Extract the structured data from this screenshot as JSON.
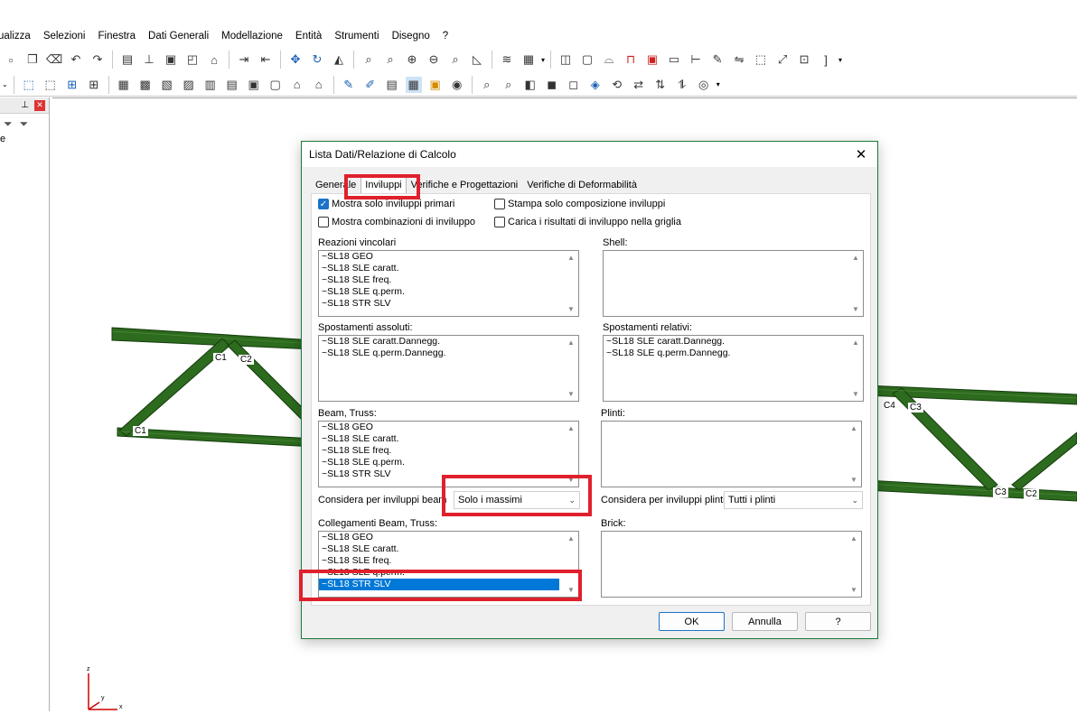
{
  "menu": [
    "ualizza",
    "Selezioni",
    "Finestra",
    "Dati Generali",
    "Modellazione",
    "Entità",
    "Strumenti",
    "Disegno",
    "?"
  ],
  "left_panel": {
    "text": "e"
  },
  "model_labels": [
    "C1",
    "C2",
    "C1",
    "C4",
    "C3",
    "C3",
    "C2"
  ],
  "dialog": {
    "title": "Lista Dati/Relazione di Calcolo",
    "tabs": [
      "Generale",
      "Inviluppi",
      "Verifiche e Progettazioni",
      "Verifiche di Deformabilità"
    ],
    "active_tab": "Inviluppi",
    "checkboxes": [
      {
        "label": "Mostra solo inviluppi primari",
        "checked": true
      },
      {
        "label": "Stampa solo composizione inviluppi",
        "checked": false
      },
      {
        "label": "Mostra combinazioni di inviluppo",
        "checked": false
      },
      {
        "label": "Carica i risultati di inviluppo nella griglia",
        "checked": false
      }
    ],
    "groups": {
      "reazioni": {
        "label": "Reazioni vincolari",
        "items": [
          "~SL18 GEO",
          "~SL18 SLE caratt.",
          "~SL18 SLE freq.",
          "~SL18 SLE q.perm.",
          "~SL18 STR SLV"
        ]
      },
      "shell": {
        "label": "Shell:",
        "items": []
      },
      "spost_ass": {
        "label": "Spostamenti assoluti:",
        "items": [
          "~SL18 SLE caratt.Dannegg.",
          "~SL18 SLE q.perm.Dannegg."
        ]
      },
      "spost_rel": {
        "label": "Spostamenti relativi:",
        "items": [
          "~SL18 SLE caratt.Dannegg.",
          "~SL18 SLE q.perm.Dannegg."
        ]
      },
      "beam": {
        "label": "Beam, Truss:",
        "items": [
          "~SL18 GEO",
          "~SL18 SLE caratt.",
          "~SL18 SLE freq.",
          "~SL18 SLE q.perm.",
          "~SL18 STR SLV"
        ]
      },
      "plinti": {
        "label": "Plinti:",
        "items": []
      },
      "collegamenti": {
        "label": "Collegamenti Beam, Truss:",
        "items": [
          "~SL18 GEO",
          "~SL18 SLE caratt.",
          "~SL18 SLE freq.",
          "~SL18 SLE q.perm.",
          "~SL18 STR SLV"
        ],
        "selected": "~SL18 STR SLV"
      },
      "brick": {
        "label": "Brick:",
        "items": []
      }
    },
    "beam_envelope": {
      "label": "Considera per inviluppi beam",
      "value": "Solo i massimi"
    },
    "plinti_envelope": {
      "label": "Considera per inviluppi plinti",
      "value": "Tutti i plinti"
    },
    "buttons": {
      "ok": "OK",
      "cancel": "Annulla",
      "help": "?"
    }
  },
  "axes": {
    "z": "z",
    "y": "y",
    "x": "x"
  },
  "colors": {
    "highlight": "#e0202c",
    "selection": "#0078d7",
    "beam": "#2d6b1f",
    "dialog_border": "#1b7a3a"
  }
}
